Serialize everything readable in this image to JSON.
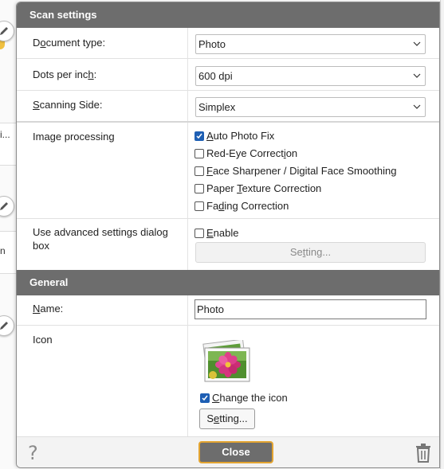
{
  "background_window": {
    "snippet_1": "i...",
    "snippet_2": "n"
  },
  "scan_settings": {
    "header": "Scan settings",
    "document_type": {
      "label": "Document type:",
      "value": "Photo"
    },
    "dots_per_inch": {
      "label": "Dots per inch:",
      "value": "600 dpi"
    },
    "scanning_side": {
      "label": "Scanning Side:",
      "value": "Simplex"
    },
    "image_processing": {
      "label": "Image processing",
      "options": [
        {
          "label": "Auto Photo Fix",
          "checked": true
        },
        {
          "label": "Red-Eye Correction",
          "checked": false
        },
        {
          "label": "Face Sharpener / Digital Face Smoothing",
          "checked": false
        },
        {
          "label": "Paper Texture Correction",
          "checked": false
        },
        {
          "label": "Fading Correction",
          "checked": false
        }
      ]
    },
    "advanced": {
      "label": "Use advanced settings dialog box",
      "enable_label": "Enable",
      "enable_checked": false,
      "setting_button": "Setting..."
    }
  },
  "general": {
    "header": "General",
    "name": {
      "label": "Name:",
      "value": "Photo"
    },
    "icon": {
      "label": "Icon",
      "change_label": "Change the icon",
      "change_checked": true,
      "setting_button": "Setting..."
    }
  },
  "footer": {
    "help_icon": "question-mark",
    "close_button": "Close",
    "delete_icon": "trash-can"
  },
  "colors": {
    "header_bg": "#6d6d6d",
    "close_border": "#e3a431",
    "checkbox_checked": "#1e5fb4"
  }
}
